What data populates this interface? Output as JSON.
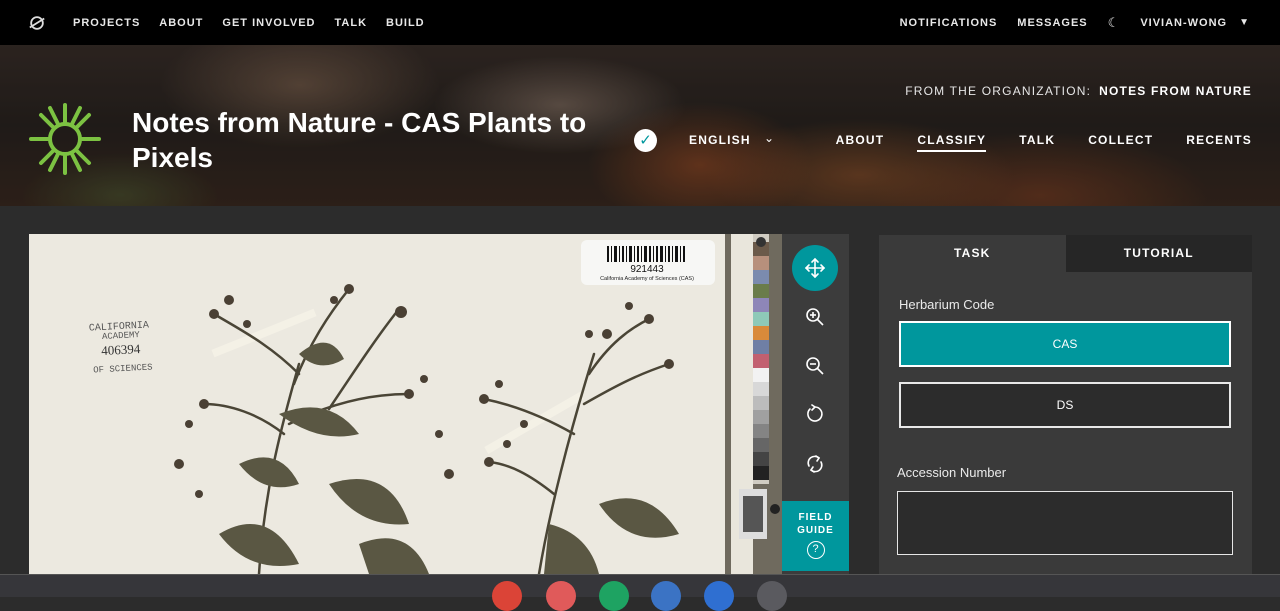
{
  "topnav": {
    "left_links": [
      "PROJECTS",
      "ABOUT",
      "GET INVOLVED",
      "TALK",
      "BUILD"
    ],
    "notifications": "NOTIFICATIONS",
    "messages": "MESSAGES",
    "username": "VIVIAN-WONG"
  },
  "hero": {
    "title": "Notes from Nature - CAS Plants to Pixels",
    "language": "ENGLISH",
    "org_prefix": "FROM THE ORGANIZATION:",
    "org_name": "NOTES FROM NATURE",
    "nav": [
      "ABOUT",
      "CLASSIFY",
      "TALK",
      "COLLECT",
      "RECENTS"
    ],
    "active_nav": "CLASSIFY"
  },
  "subject": {
    "barcode_number": "921443",
    "barcode_caption": "California Academy of Sciences (CAS)",
    "stamp_line1": "CALIFORNIA",
    "stamp_line2": "ACADEMY",
    "stamp_number": "406394",
    "stamp_line3": "OF SCIENCES"
  },
  "toolbar": {
    "tools": [
      "move-icon",
      "zoom-in-icon",
      "zoom-out-icon",
      "rotate-icon",
      "reset-icon"
    ],
    "field_guide": "FIELD GUIDE"
  },
  "task": {
    "tabs": [
      "TASK",
      "TUTORIAL"
    ],
    "question1": "Herbarium Code",
    "answers": [
      "CAS",
      "DS"
    ],
    "selected_answer": "CAS",
    "question2": "Accession Number",
    "accession_value": ""
  },
  "colors": {
    "accent": "#00979d",
    "panel": "#3a3a3a",
    "background": "#2c2c2c"
  }
}
